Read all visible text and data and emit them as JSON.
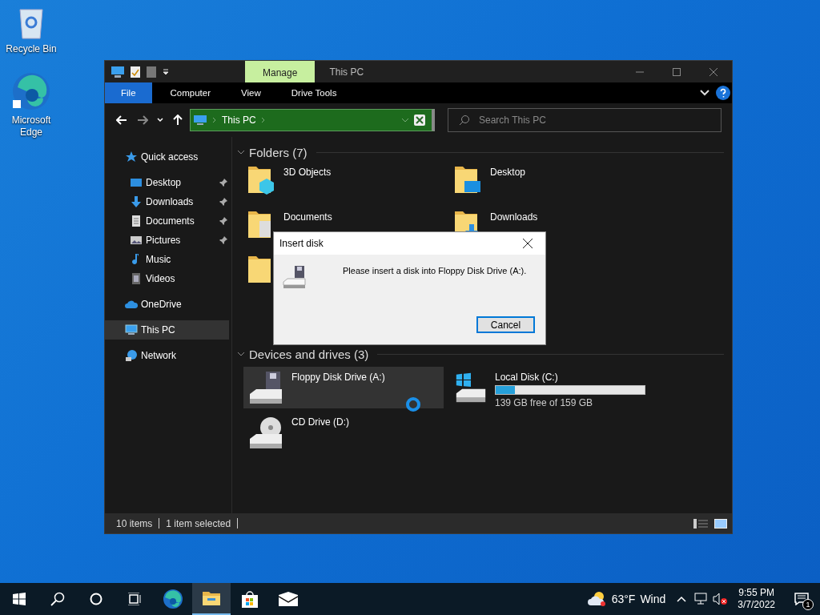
{
  "desktop_icons": [
    {
      "kind": "recycle",
      "label": "Recycle Bin"
    },
    {
      "kind": "edge",
      "label": "Microsoft Edge"
    }
  ],
  "window": {
    "title": "This PC",
    "context_tab": "Manage",
    "ribbon_tabs": [
      {
        "label": "File",
        "kind": "file",
        "selected": false
      },
      {
        "label": "Computer",
        "kind": "tab",
        "selected": false
      },
      {
        "label": "View",
        "kind": "tab",
        "selected": false
      },
      {
        "label": "Drive Tools",
        "kind": "tab",
        "selected": false
      }
    ],
    "address": {
      "path": "This PC"
    },
    "search": {
      "placeholder": "Search This PC"
    },
    "nav": [
      {
        "label": "Quick access",
        "kind": "star",
        "selected": false,
        "children": [
          {
            "label": "Desktop",
            "kind": "desktop",
            "pinned": true,
            "selected": false
          },
          {
            "label": "Downloads",
            "kind": "download",
            "pinned": true,
            "selected": false
          },
          {
            "label": "Documents",
            "kind": "document",
            "pinned": true,
            "selected": false
          },
          {
            "label": "Pictures",
            "kind": "picture",
            "pinned": true,
            "selected": false
          },
          {
            "label": "Music",
            "kind": "music",
            "pinned": false,
            "selected": false
          },
          {
            "label": "Videos",
            "kind": "video",
            "pinned": false,
            "selected": false
          }
        ]
      },
      {
        "label": "OneDrive",
        "kind": "cloud",
        "selected": false
      },
      {
        "label": "This PC",
        "kind": "pc",
        "selected": true
      },
      {
        "label": "Network",
        "kind": "network",
        "selected": false
      }
    ],
    "folders": {
      "heading": "Folders (7)",
      "items": [
        {
          "name": "3D Objects",
          "kind": "cube"
        },
        {
          "name": "Desktop",
          "kind": "desktop"
        },
        {
          "name": "Documents",
          "kind": "document"
        },
        {
          "name": "Downloads",
          "kind": "download"
        }
      ]
    },
    "drives": {
      "heading": "Devices and drives (3)",
      "items": [
        {
          "name": "Floppy Disk Drive (A:)",
          "kind": "floppy",
          "selected": true
        },
        {
          "name": "Local Disk (C:)",
          "kind": "system",
          "selected": false,
          "level": 0.13,
          "space": "139 GB free of 159 GB"
        },
        {
          "name": "CD Drive (D:)",
          "kind": "cd",
          "selected": false
        }
      ]
    },
    "status_bar": {
      "count": "10 items",
      "selection": "1 item selected"
    }
  },
  "dialog": {
    "title": "Insert disk",
    "message": "Please insert a disk into Floppy Disk Drive (A:).",
    "buttons": [
      "Cancel"
    ]
  },
  "taskbar": {
    "weather": {
      "temperature": "63°F",
      "condition": "Wind"
    },
    "time": "9:55 PM",
    "date": "3/7/2022",
    "notifications": "1"
  }
}
